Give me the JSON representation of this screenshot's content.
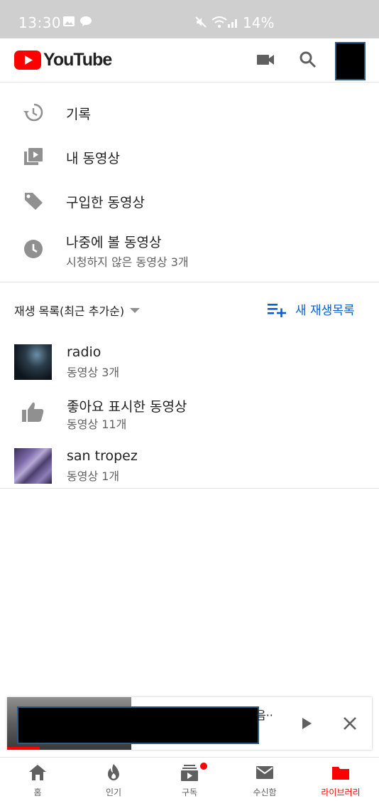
{
  "status_bar": {
    "time": "13:30",
    "battery": "14%"
  },
  "header": {
    "logo_text": "YouTube"
  },
  "menu": [
    {
      "label": "기록",
      "icon": "history-icon"
    },
    {
      "label": "내 동영상",
      "icon": "my-videos-icon"
    },
    {
      "label": "구입한 동영상",
      "icon": "tag-icon"
    },
    {
      "label": "나중에 볼 동영상",
      "sub": "시청하지 않은 동영상 3개",
      "icon": "clock-icon"
    }
  ],
  "playlists_header": {
    "sort_label": "재생 목록(최근 추가순)",
    "new_playlist_label": "새 재생목록"
  },
  "playlists": [
    {
      "title": "radio",
      "sub": "동영상 3개"
    },
    {
      "title": "좋아요 표시한 동영상",
      "sub": "동영상 11개"
    },
    {
      "title": "san tropez",
      "sub": "동영상 1개"
    }
  ],
  "miniplayer": {
    "title_fragment": "음··",
    "progress_fraction": 0.09
  },
  "bottom_nav": [
    {
      "label": "홈",
      "icon": "home-icon"
    },
    {
      "label": "인기",
      "icon": "trending-icon"
    },
    {
      "label": "구독",
      "icon": "subscriptions-icon"
    },
    {
      "label": "수신함",
      "icon": "inbox-icon"
    },
    {
      "label": "라이브러리",
      "icon": "library-icon",
      "active": true
    }
  ],
  "colors": {
    "brand_red": "#ff0000",
    "link_blue": "#065fd4",
    "icon_gray": "#909090"
  }
}
